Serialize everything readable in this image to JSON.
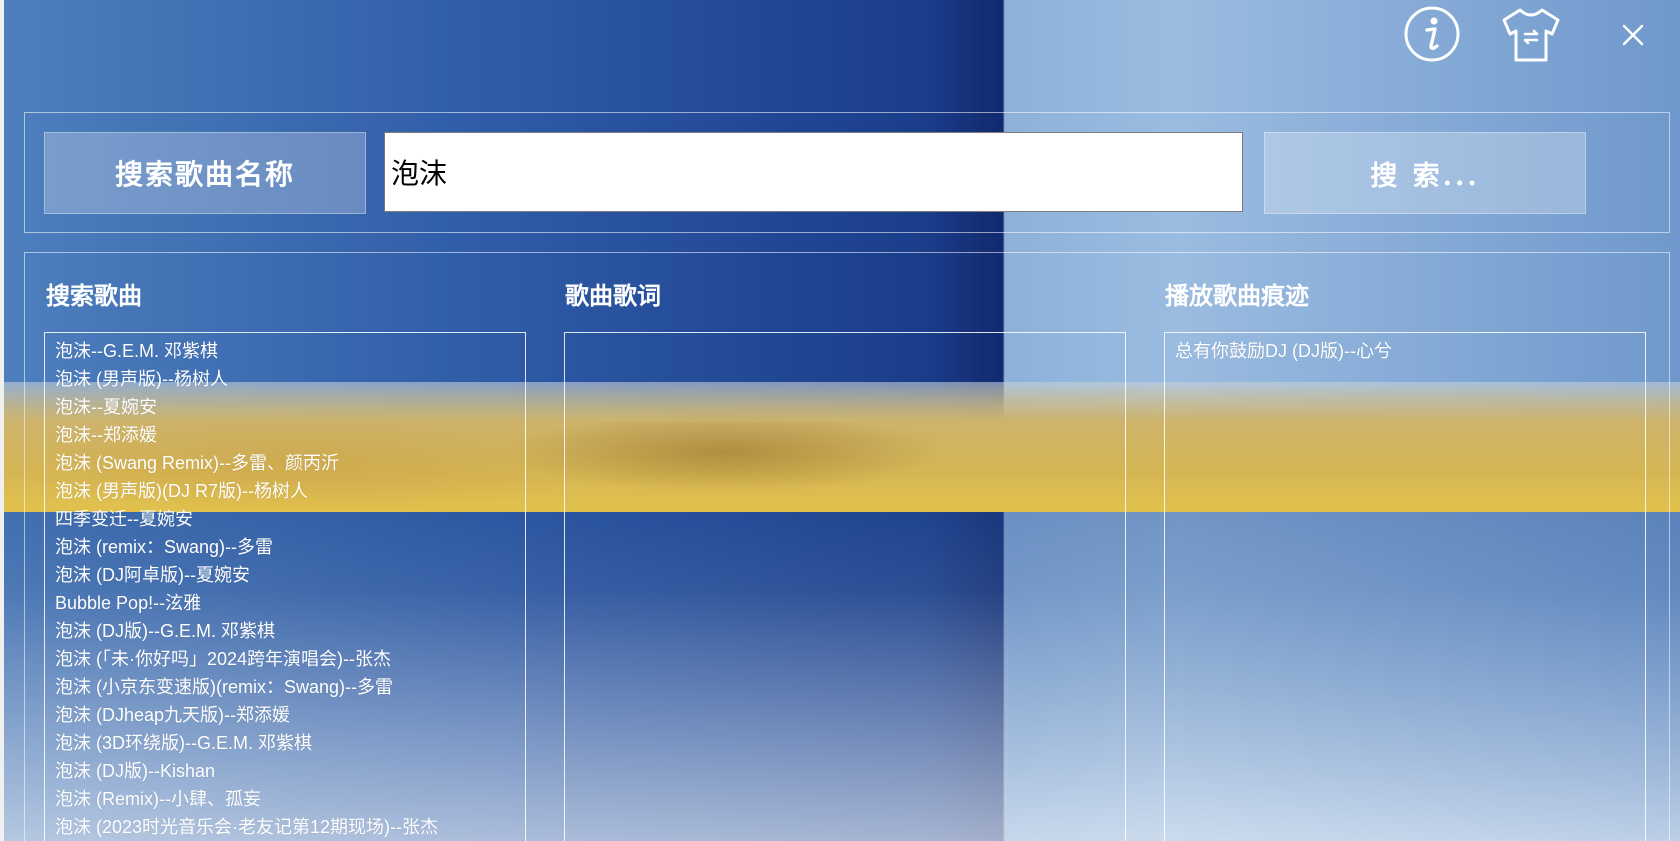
{
  "search": {
    "label": "搜索歌曲名称",
    "query": "泡沫",
    "button_label": "搜 索..."
  },
  "sections": {
    "results_title": "搜索歌曲",
    "lyrics_title": "歌曲歌词",
    "history_title": "播放歌曲痕迹"
  },
  "results": [
    "泡沫--G.E.M. 邓紫棋",
    "泡沫 (男声版)--杨树人",
    "泡沫--夏婉安",
    "泡沫--郑添媛",
    "泡沫 (Swang Remix)--多雷、颜丙沂",
    "泡沫 (男声版)(DJ R7版)--杨树人",
    "四季变迁--夏婉安",
    "泡沫 (remix：Swang)--多雷",
    "泡沫 (DJ阿卓版)--夏婉安",
    "Bubble Pop!--泫雅",
    "泡沫 (DJ版)--G.E.M. 邓紫棋",
    "泡沫 (「未·你好吗」2024跨年演唱会)--张杰",
    "泡沫 (小京东变速版)(remix：Swang)--多雷",
    "泡沫 (DJheap九天版)--郑添媛",
    "泡沫 (3D环绕版)--G.E.M. 邓紫棋",
    "泡沫 (DJ版)--Kishan",
    "泡沫 (Remix)--小肆、孤妄",
    "泡沫 (2023时光音乐会·老友记第12期现场)--张杰"
  ],
  "lyrics": [],
  "history": [
    "总有你鼓励DJ (DJ版)--心兮"
  ],
  "icons": {
    "info": "info-icon",
    "skin": "tshirt-skin-icon",
    "close": "close-icon"
  }
}
